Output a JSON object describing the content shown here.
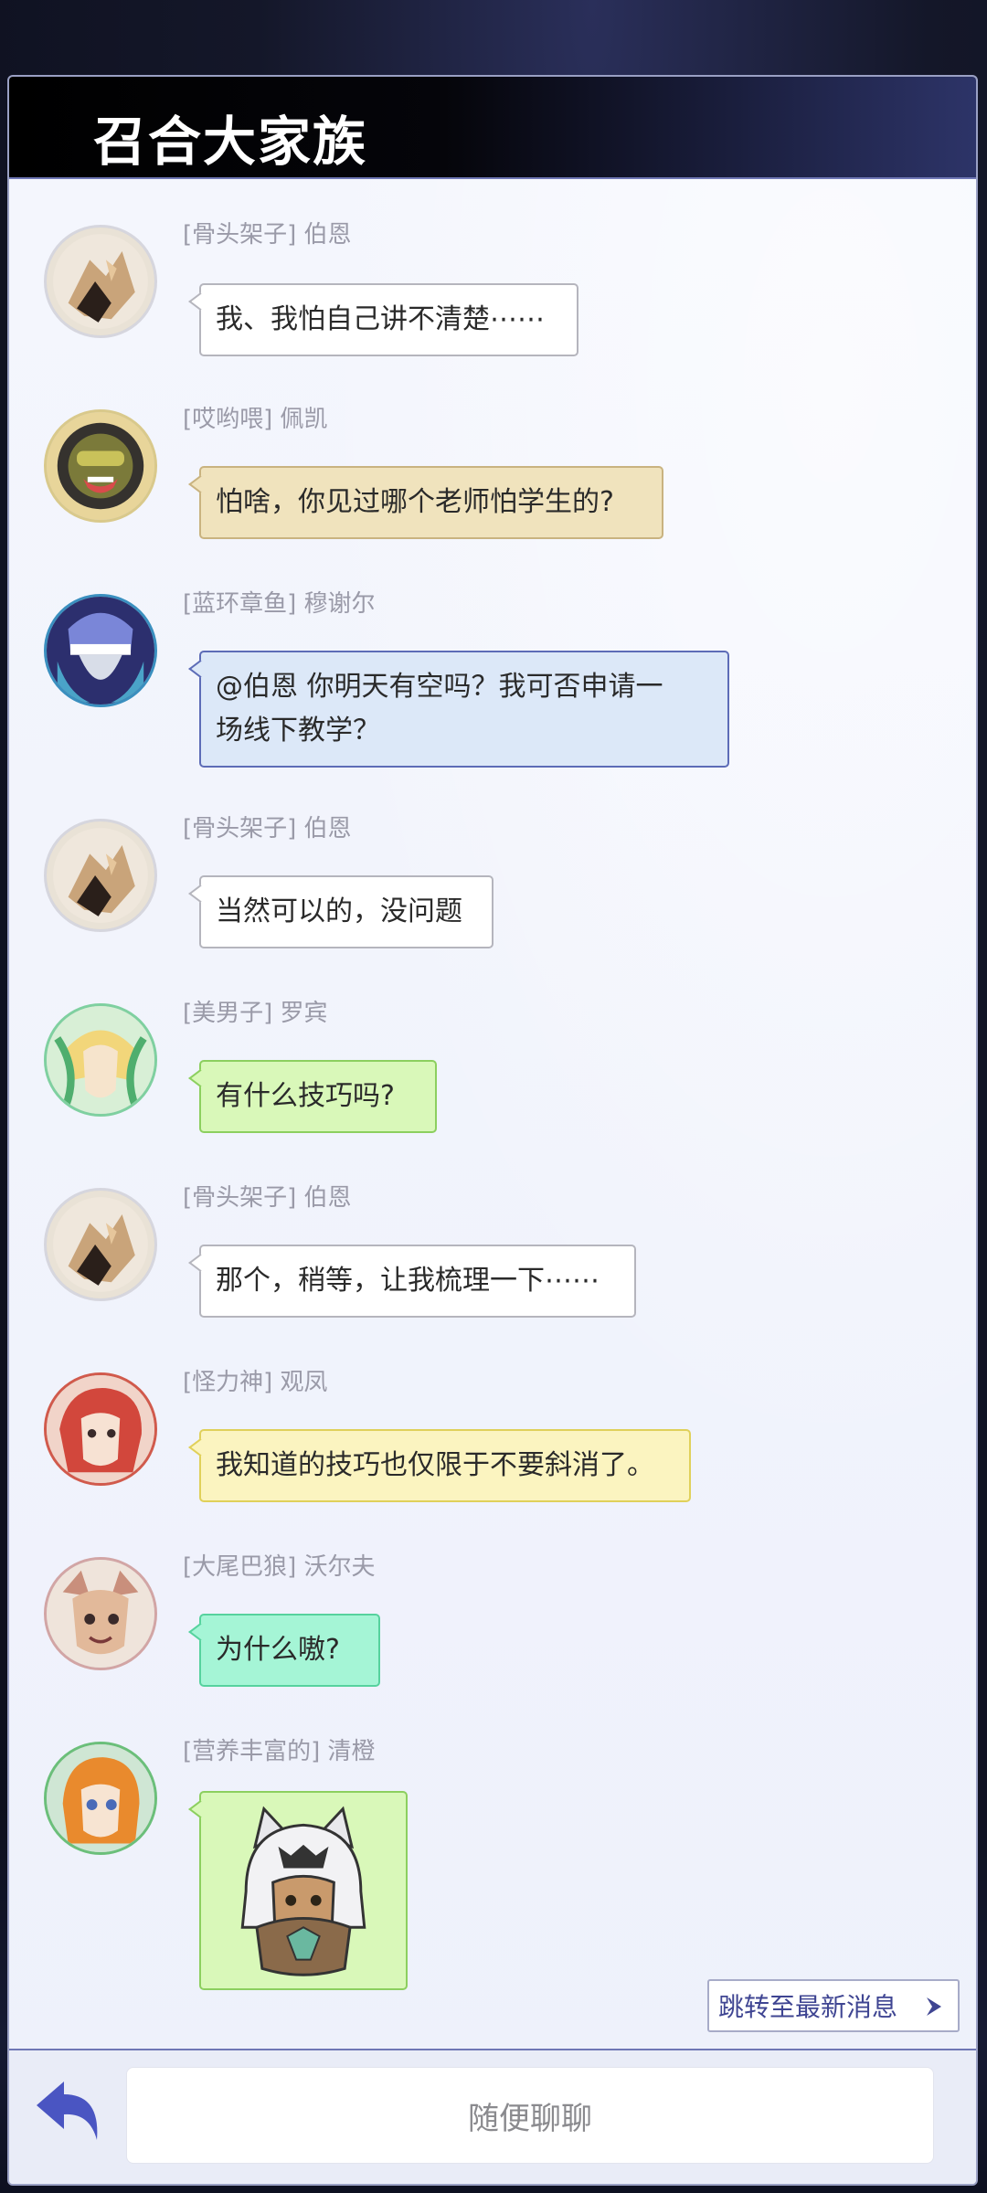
{
  "header": {
    "title": "召合大家族"
  },
  "messages": [
    {
      "sender": "[骨头架子] 伯恩",
      "text": "我、我怕自己讲不清楚⋯⋯",
      "avatar": "bone-character-avatar"
    },
    {
      "sender": "[哎哟喂] 佩凯",
      "text": "怕啥，你见过哪个老师怕学生的?",
      "avatar": "goggles-character-avatar"
    },
    {
      "sender": "[蓝环章鱼] 穆谢尔",
      "text_lines": [
        "@伯恩 你明天有空吗？我可否申请一",
        "场线下教学？"
      ],
      "avatar": "octopus-character-avatar"
    },
    {
      "sender": "[骨头架子] 伯恩",
      "text": "当然可以的，没问题",
      "avatar": "bone-character-avatar"
    },
    {
      "sender": "[美男子] 罗宾",
      "text": "有什么技巧吗?",
      "avatar": "blonde-character-avatar"
    },
    {
      "sender": "[骨头架子] 伯恩",
      "text": "那个，稍等，让我梳理一下⋯⋯",
      "avatar": "bone-character-avatar"
    },
    {
      "sender": "[怪力神] 观凤",
      "text": "我知道的技巧也仅限于不要斜消了。",
      "avatar": "redhair-character-avatar"
    },
    {
      "sender": "[大尾巴狼] 沃尔夫",
      "text": "为什么嗷?",
      "avatar": "wolf-character-avatar"
    },
    {
      "sender": "[营养丰富的] 清橙",
      "sticker": "wolf-hood-sticker",
      "avatar": "orange-hair-character-avatar"
    }
  ],
  "jump_button": {
    "label": "跳转至最新消息"
  },
  "footer": {
    "input_placeholder": "随便聊聊",
    "back_icon": "reply-arrow-icon"
  },
  "colors": {
    "header_bg": "#000000",
    "panel_bg": "#f2f4fc",
    "accent": "#3f4592",
    "bubble_tan": "#f0e3bd",
    "bubble_blue": "#dce8f8",
    "bubble_green": "#d9f8b9",
    "bubble_yellow": "#fbf4c0",
    "bubble_mint": "#a5f5d6"
  }
}
